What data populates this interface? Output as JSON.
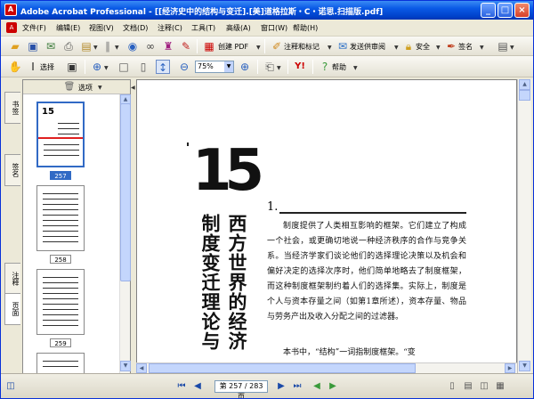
{
  "window": {
    "title": "Adobe Acrobat Professional - [[经济史中的结构与变迁].[美]道格拉斯・C・诺思.扫描版.pdf]",
    "minimize": "_",
    "maximize": "□",
    "close": "×"
  },
  "menu": [
    "文件(F)",
    "编辑(E)",
    "视图(V)",
    "文档(D)",
    "注释(C)",
    "工具(T)",
    "高级(A)",
    "窗口(W)",
    "帮助(H)"
  ],
  "toolbar1": {
    "create_pdf": "创建 PDF",
    "comment_markup": "注释和标记",
    "send_review": "发送供审阅",
    "security": "安全",
    "sign": "签名"
  },
  "toolbar2": {
    "select": "选择",
    "zoom_value": "75%",
    "help": "帮助"
  },
  "nav_panel": {
    "options": "选项",
    "tabs": [
      "书签",
      "签名",
      "注释",
      "页面"
    ],
    "thumbs": [
      {
        "label": "257",
        "selected": true
      },
      {
        "label": "258",
        "selected": false
      },
      {
        "label": "259",
        "selected": false
      }
    ]
  },
  "status": {
    "page_box": "第 257 / 283 页"
  },
  "document": {
    "chapter_number": "15",
    "title_col1": "西方世界的经济",
    "title_col2": "制度变迁理论与",
    "section_number": "1.",
    "paragraph1": "制度提供了人类相互影响的框架。它们建立了构成一个社会，或更确切地说一种经济秩序的合作与竞争关系。当经济学家们谈论他们的选择理论决策以及机会和偏好决定的选择次序时，他们简单地略去了制度框架，而这种制度框架制约着人们的选择集。实际上，制度是个人与资本存量之间（如第1章所述），资本存量、物品与劳务产出及收入分配之间的过滤器。",
    "paragraph2": "本书中，“结构”一词指制度框架。“变"
  },
  "colors": {
    "title_bar": "#0a5ae6",
    "selected_thumb": "#316ac5",
    "window_bg": "#ece9d8"
  }
}
